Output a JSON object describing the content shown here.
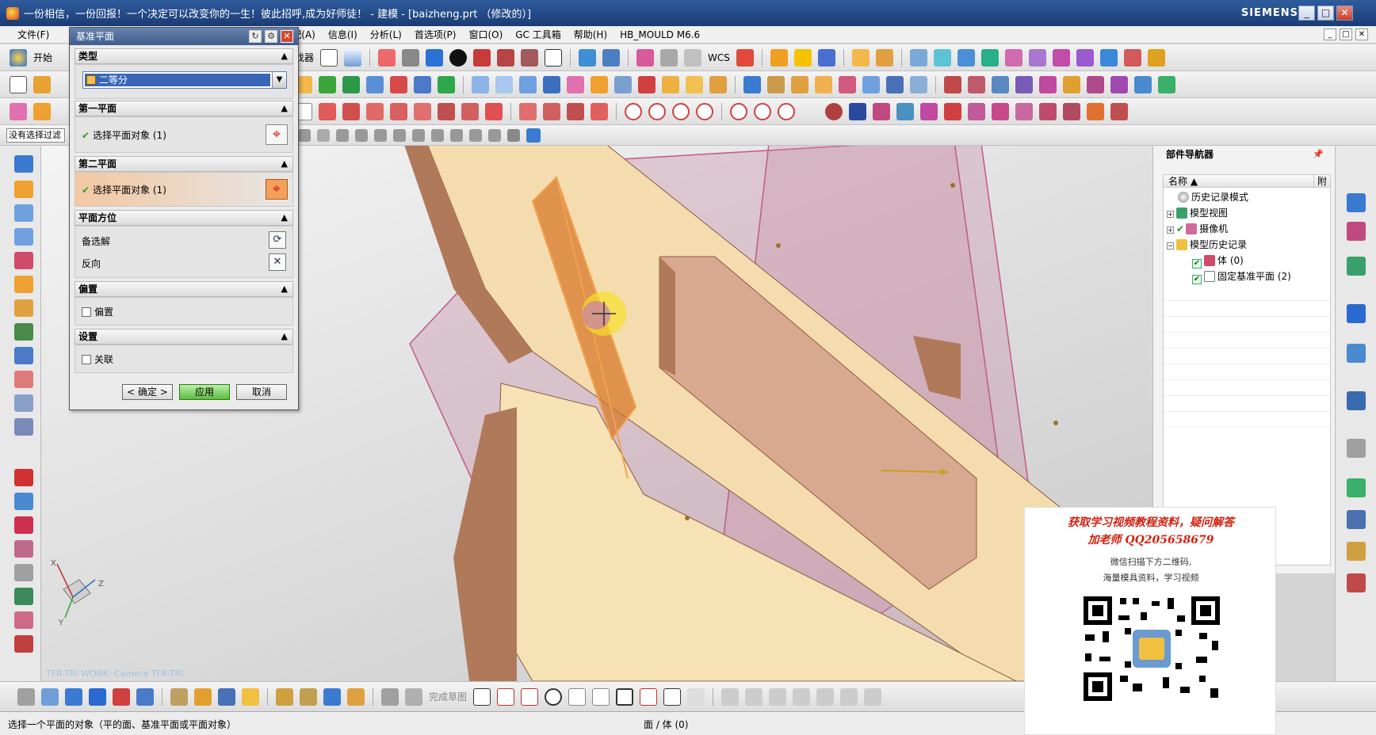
{
  "window": {
    "title": "一份相信，一份回报！一个决定可以改变你的一生！彼此招呼,成为好师徒！ - 建模 - [baizheng.prt （修改的）]",
    "brand": "SIEMENS",
    "controls": [
      "_",
      "□",
      "✕"
    ]
  },
  "menu": {
    "items": [
      "文件(F)",
      "配(A)",
      "信息(I)",
      "分析(L)",
      "首选项(P)",
      "窗口(O)",
      "GC 工具箱",
      "帮助(H)",
      "HB_MOULD M6.6"
    ],
    "mdi_controls": [
      "_",
      "□",
      "✕"
    ]
  },
  "toolbar": {
    "start_label": "开始",
    "command_finder": "命令查找器",
    "wcs_label": "WCS",
    "selection_filter": "没有选择过滤",
    "bottom_sketch_label": "完成草图"
  },
  "dialog": {
    "title": "基准平面",
    "sections": {
      "type": {
        "header": "类型",
        "value": "二等分"
      },
      "first_plane": {
        "header": "第一平面",
        "row": "选择平面对象 (1)"
      },
      "second_plane": {
        "header": "第二平面",
        "row": "选择平面对象 (1)"
      },
      "orientation": {
        "header": "平面方位",
        "alt_solution": "备选解",
        "reverse": "反向"
      },
      "offset": {
        "header": "偏置",
        "checkbox": "偏置"
      },
      "settings": {
        "header": "设置",
        "checkbox": "关联"
      }
    },
    "buttons": {
      "ok": "< 确定 >",
      "apply": "应用",
      "cancel": "取消"
    }
  },
  "viewport": {
    "orientation_label": "TFR-TRI WORK: Camera TFR-TRI",
    "axes": {
      "x": "X",
      "y": "Y",
      "z": "Z"
    }
  },
  "navigator": {
    "title": "部件导航器",
    "columns": {
      "name": "名称",
      "attach": "附"
    },
    "nodes": [
      {
        "label": "历史记录模式"
      },
      {
        "label": "模型视图"
      },
      {
        "label": "摄像机"
      },
      {
        "label": "模型历史记录"
      },
      {
        "label": "体 (0)"
      },
      {
        "label": "固定基准平面 (2)"
      }
    ]
  },
  "status": {
    "message": "选择一个平面的对象（平的面、基准平面或平面对象）",
    "selection": "面 / 体 (0)"
  },
  "ad": {
    "line1": "获取学习视频教程资料，疑问解答",
    "line2": "加老师 QQ205658679",
    "line3": "微信扫描下方二维码,",
    "line4": "海量模具资料，学习视频"
  },
  "colors": {
    "title_bar": "#1b3c74",
    "part_body": "#f5dcae",
    "part_shadow": "#b07a5a",
    "datum_plane": "#c98aa3",
    "selected_face": "#d57a2a",
    "ad_text": "#d3200f"
  }
}
